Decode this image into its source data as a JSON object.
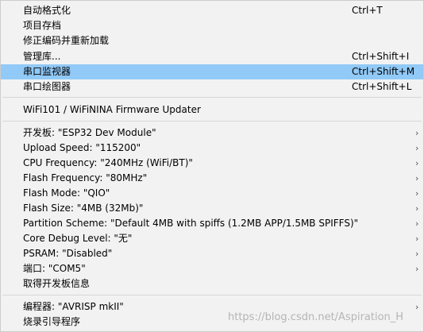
{
  "menu": {
    "items": [
      {
        "label": "自动格式化",
        "shortcut": "Ctrl+T"
      },
      {
        "label": "项目存档",
        "shortcut": ""
      },
      {
        "label": "修正编码并重新加载",
        "shortcut": ""
      },
      {
        "label": "管理库...",
        "shortcut": "Ctrl+Shift+I"
      },
      {
        "label": "串口监视器",
        "shortcut": "Ctrl+Shift+M"
      },
      {
        "label": "串口绘图器",
        "shortcut": "Ctrl+Shift+L"
      },
      {
        "label": "WiFi101 / WiFiNINA Firmware Updater",
        "shortcut": ""
      },
      {
        "label": "开发板: \"ESP32 Dev Module\"",
        "arrow": "›"
      },
      {
        "label": "Upload Speed: \"115200\"",
        "arrow": "›"
      },
      {
        "label": "CPU Frequency: \"240MHz (WiFi/BT)\"",
        "arrow": "›"
      },
      {
        "label": "Flash Frequency: \"80MHz\"",
        "arrow": "›"
      },
      {
        "label": "Flash Mode: \"QIO\"",
        "arrow": "›"
      },
      {
        "label": "Flash Size: \"4MB (32Mb)\"",
        "arrow": "›"
      },
      {
        "label": "Partition Scheme: \"Default 4MB with spiffs (1.2MB APP/1.5MB SPIFFS)\"",
        "arrow": "›"
      },
      {
        "label": "Core Debug Level: \"无\"",
        "arrow": "›"
      },
      {
        "label": "PSRAM: \"Disabled\"",
        "arrow": "›"
      },
      {
        "label": "端口: \"COM5\"",
        "arrow": "›"
      },
      {
        "label": "取得开发板信息",
        "arrow": ""
      },
      {
        "label": "编程器: \"AVRISP mkII\"",
        "arrow": "›"
      },
      {
        "label": "烧录引导程序",
        "arrow": ""
      }
    ]
  },
  "watermark": "https://blog.csdn.net/Aspiration_H",
  "colors": {
    "menu_background": "#f2f2f2",
    "highlight": "#91c9f7",
    "separator": "#d7d7d7"
  }
}
